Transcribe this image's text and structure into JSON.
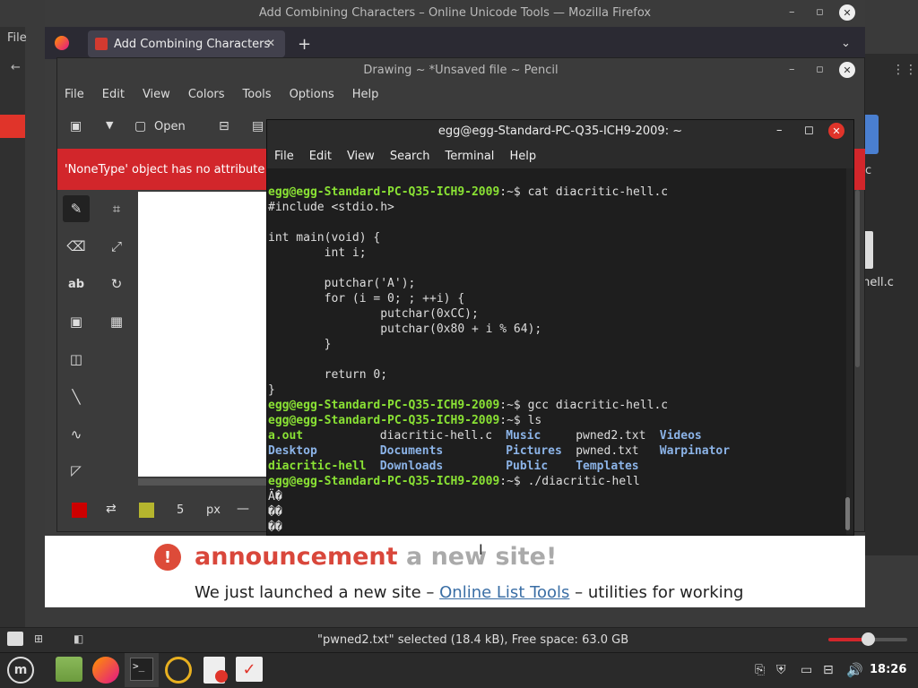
{
  "firefox": {
    "title": "Add Combining Characters – Online Unicode Tools — Mozilla Firefox",
    "tab_label": "Add Combining Characters",
    "new_tab": "+",
    "announcement_word": "announcement",
    "announcement_rest": "a new site!",
    "launch_text_before": "We just launched a new site –",
    "launch_link": "Online List Tools",
    "launch_text_after": "– utilities for working"
  },
  "bg_window": {
    "menu_file": "File",
    "file_label": ".hell.c",
    "side_c": "c"
  },
  "pencil": {
    "title": "Drawing ~ *Unsaved file ~ Pencil",
    "menu": [
      "File",
      "Edit",
      "View",
      "Colors",
      "Tools",
      "Options",
      "Help"
    ],
    "open_label": "Open",
    "error": "'NoneType' object has no attribute 're",
    "size_value": "5",
    "size_unit": "px",
    "colors": {
      "primary": "#cc0000",
      "secondary": "#b5b52e"
    }
  },
  "terminal": {
    "title": "egg@egg-Standard-PC-Q35-ICH9-2009: ~",
    "menu": [
      "File",
      "Edit",
      "View",
      "Search",
      "Terminal",
      "Help"
    ],
    "prompt": "egg@egg-Standard-PC-Q35-ICH9-2009",
    "prompt_suffix": ":~$ ",
    "cmd1": "cat diacritic-hell.c",
    "code": "#include <stdio.h>\n\nint main(void) {\n        int i;\n\n        putchar('A');\n        for (i = 0; ; ++i) {\n                putchar(0xCC);\n                putchar(0x80 + i % 64);\n        }\n\n        return 0;\n}",
    "cmd2": "gcc diacritic-hell.c",
    "cmd3": "ls",
    "ls": [
      [
        {
          "t": "a.out",
          "c": "g"
        },
        {
          "t": "diacritic-hell.c",
          "c": ""
        },
        {
          "t": "Music",
          "c": "b"
        },
        {
          "t": "pwned2.txt",
          "c": ""
        },
        {
          "t": "Videos",
          "c": "b"
        }
      ],
      [
        {
          "t": "Desktop",
          "c": "b"
        },
        {
          "t": "Documents",
          "c": "b"
        },
        {
          "t": "Pictures",
          "c": "b"
        },
        {
          "t": "pwned.txt",
          "c": ""
        },
        {
          "t": "Warpinator",
          "c": "b"
        }
      ],
      [
        {
          "t": "diacritic-hell",
          "c": "g"
        },
        {
          "t": "Downloads",
          "c": "b"
        },
        {
          "t": "Public",
          "c": "b"
        },
        {
          "t": "Templates",
          "c": "b"
        },
        {
          "t": "",
          "c": ""
        }
      ]
    ],
    "cmd4": "./diacritic-hell",
    "out": [
      "Ä�",
      "��",
      "��",
      "�"
    ]
  },
  "statusbar": {
    "text": "\"pwned2.txt\" selected (18.4 kB), Free space: 63.0 GB"
  },
  "taskbar": {
    "clock": "18:26"
  }
}
